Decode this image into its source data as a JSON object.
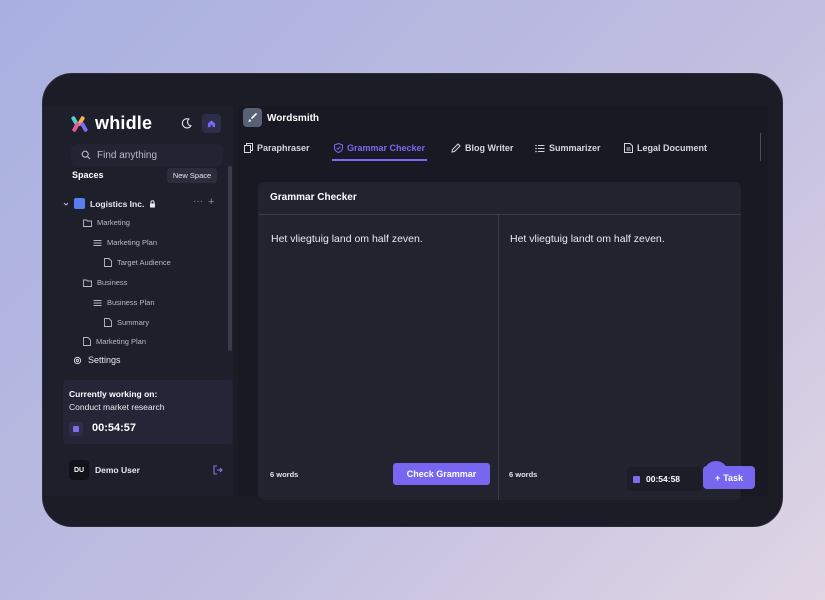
{
  "app": {
    "brand": "whidle",
    "title": "Wordsmith"
  },
  "colors": {
    "accent": "#7766f0",
    "background": "#1b1c26",
    "panel": "#21232f"
  },
  "sidebar": {
    "search_placeholder": "Find anything",
    "spaces_label": "Spaces",
    "new_space_label": "New Space",
    "workspace": "Logistics Inc.",
    "tree": [
      {
        "label": "Marketing",
        "icon": "folder-icon"
      },
      {
        "label": "Marketing Plan",
        "icon": "list-icon"
      },
      {
        "label": "Target Audience",
        "icon": "document-icon"
      },
      {
        "label": "Business",
        "icon": "folder-icon"
      },
      {
        "label": "Business Plan",
        "icon": "list-icon"
      },
      {
        "label": "Summary",
        "icon": "document-icon"
      },
      {
        "label": "Marketing Plan",
        "icon": "document-icon"
      }
    ],
    "settings_label": "Settings",
    "working": {
      "title": "Currently working on:",
      "task": "Conduct market research",
      "timer": "00:54:57"
    },
    "user": {
      "initials": "DU",
      "name": "Demo User"
    }
  },
  "tabs": [
    {
      "label": "Paraphraser",
      "icon": "copy-icon"
    },
    {
      "label": "Grammar Checker",
      "icon": "shield-check-icon"
    },
    {
      "label": "Blog Writer",
      "icon": "edit-icon"
    },
    {
      "label": "Summarizer",
      "icon": "list-icon"
    },
    {
      "label": "Legal Document",
      "icon": "document-icon"
    }
  ],
  "active_tab": "Grammar Checker",
  "card": {
    "title": "Grammar Checker",
    "input_text": "Het vliegtuig land om half zeven.",
    "output_text": "Het vliegtuig landt om half zeven.",
    "input_word_count": "6 words",
    "output_word_count": "6 words",
    "check_button": "Check Grammar"
  },
  "floating": {
    "timer": "00:54:58",
    "task_button": "Task"
  }
}
